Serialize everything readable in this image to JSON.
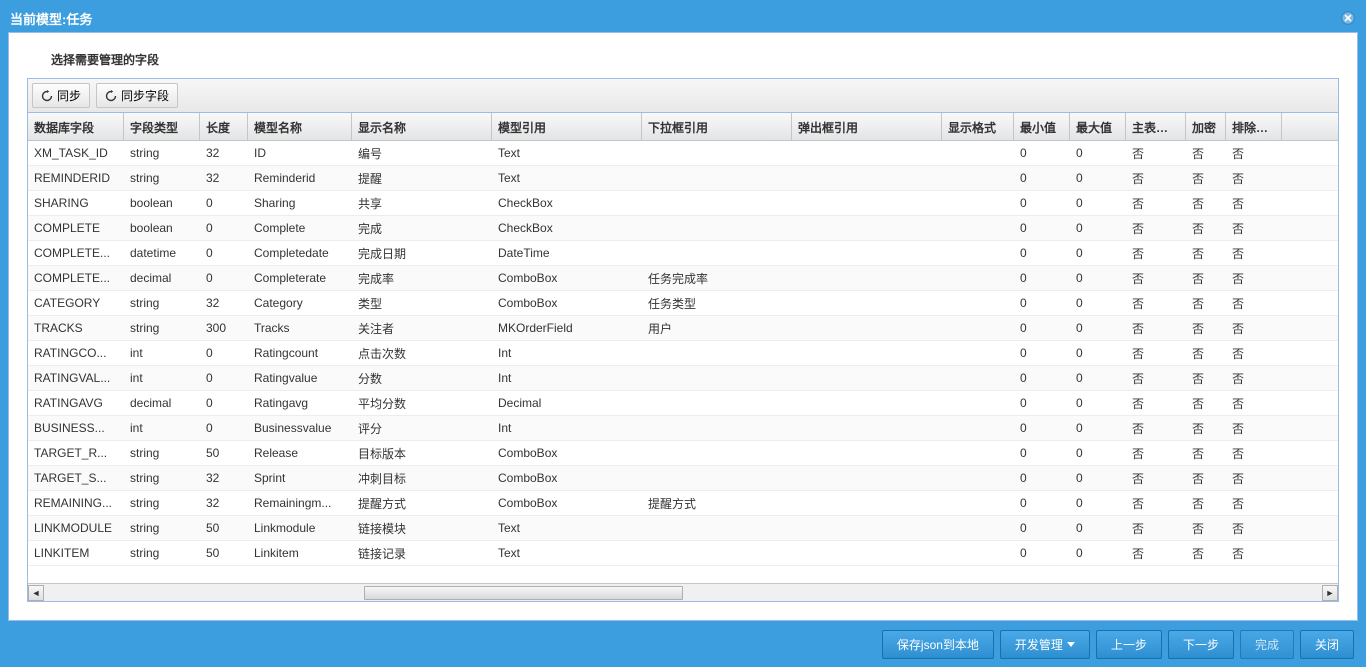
{
  "title": "当前模型:任务",
  "section_label": "选择需要管理的字段",
  "toolbar": {
    "sync": "同步",
    "sync_fields": "同步字段"
  },
  "columns": {
    "db_field": "数据库字段",
    "field_type": "字段类型",
    "length": "长度",
    "model_name": "模型名称",
    "display_name": "显示名称",
    "model_ref": "模型引用",
    "dropdown_ref": "下拉框引用",
    "popup_ref": "弹出框引用",
    "display_format": "显示格式",
    "min": "最小值",
    "max": "最大值",
    "master_link": "主表连排",
    "encrypt": "加密",
    "exclude_audit": "排除审计"
  },
  "rows": [
    {
      "db": "XM_TASK_ID",
      "ft": "string",
      "len": "32",
      "mn": "ID",
      "dn": "编号",
      "mr": "Text",
      "dd": "",
      "pp": "",
      "fmt": "",
      "min": "0",
      "max": "0",
      "mst": "否",
      "enc": "否",
      "exc": "否"
    },
    {
      "db": "REMINDERID",
      "ft": "string",
      "len": "32",
      "mn": "Reminderid",
      "dn": "提醒",
      "mr": "Text",
      "dd": "",
      "pp": "",
      "fmt": "",
      "min": "0",
      "max": "0",
      "mst": "否",
      "enc": "否",
      "exc": "否"
    },
    {
      "db": "SHARING",
      "ft": "boolean",
      "len": "0",
      "mn": "Sharing",
      "dn": "共享",
      "mr": "CheckBox",
      "dd": "",
      "pp": "",
      "fmt": "",
      "min": "0",
      "max": "0",
      "mst": "否",
      "enc": "否",
      "exc": "否"
    },
    {
      "db": "COMPLETE",
      "ft": "boolean",
      "len": "0",
      "mn": "Complete",
      "dn": "完成",
      "mr": "CheckBox",
      "dd": "",
      "pp": "",
      "fmt": "",
      "min": "0",
      "max": "0",
      "mst": "否",
      "enc": "否",
      "exc": "否"
    },
    {
      "db": "COMPLETE...",
      "ft": "datetime",
      "len": "0",
      "mn": "Completedate",
      "dn": "完成日期",
      "mr": "DateTime",
      "dd": "",
      "pp": "",
      "fmt": "",
      "min": "0",
      "max": "0",
      "mst": "否",
      "enc": "否",
      "exc": "否"
    },
    {
      "db": "COMPLETE...",
      "ft": "decimal",
      "len": "0",
      "mn": "Completerate",
      "dn": "完成率",
      "mr": "ComboBox",
      "dd": "任务完成率",
      "pp": "",
      "fmt": "",
      "min": "0",
      "max": "0",
      "mst": "否",
      "enc": "否",
      "exc": "否"
    },
    {
      "db": "CATEGORY",
      "ft": "string",
      "len": "32",
      "mn": "Category",
      "dn": "类型",
      "mr": "ComboBox",
      "dd": "任务类型",
      "pp": "",
      "fmt": "",
      "min": "0",
      "max": "0",
      "mst": "否",
      "enc": "否",
      "exc": "否"
    },
    {
      "db": "TRACKS",
      "ft": "string",
      "len": "300",
      "mn": "Tracks",
      "dn": "关注者",
      "mr": "MKOrderField",
      "dd": "用户",
      "pp": "",
      "fmt": "",
      "min": "0",
      "max": "0",
      "mst": "否",
      "enc": "否",
      "exc": "否"
    },
    {
      "db": "RATINGCO...",
      "ft": "int",
      "len": "0",
      "mn": "Ratingcount",
      "dn": "点击次数",
      "mr": "Int",
      "dd": "",
      "pp": "",
      "fmt": "",
      "min": "0",
      "max": "0",
      "mst": "否",
      "enc": "否",
      "exc": "否"
    },
    {
      "db": "RATINGVAL...",
      "ft": "int",
      "len": "0",
      "mn": "Ratingvalue",
      "dn": "分数",
      "mr": "Int",
      "dd": "",
      "pp": "",
      "fmt": "",
      "min": "0",
      "max": "0",
      "mst": "否",
      "enc": "否",
      "exc": "否"
    },
    {
      "db": "RATINGAVG",
      "ft": "decimal",
      "len": "0",
      "mn": "Ratingavg",
      "dn": "平均分数",
      "mr": "Decimal",
      "dd": "",
      "pp": "",
      "fmt": "",
      "min": "0",
      "max": "0",
      "mst": "否",
      "enc": "否",
      "exc": "否"
    },
    {
      "db": "BUSINESS...",
      "ft": "int",
      "len": "0",
      "mn": "Businessvalue",
      "dn": "评分",
      "mr": "Int",
      "dd": "",
      "pp": "",
      "fmt": "",
      "min": "0",
      "max": "0",
      "mst": "否",
      "enc": "否",
      "exc": "否"
    },
    {
      "db": "TARGET_R...",
      "ft": "string",
      "len": "50",
      "mn": "Release",
      "dn": "目标版本",
      "mr": "ComboBox",
      "dd": "",
      "pp": "",
      "fmt": "",
      "min": "0",
      "max": "0",
      "mst": "否",
      "enc": "否",
      "exc": "否"
    },
    {
      "db": "TARGET_S...",
      "ft": "string",
      "len": "32",
      "mn": "Sprint",
      "dn": "冲刺目标",
      "mr": "ComboBox",
      "dd": "",
      "pp": "",
      "fmt": "",
      "min": "0",
      "max": "0",
      "mst": "否",
      "enc": "否",
      "exc": "否"
    },
    {
      "db": "REMAINING...",
      "ft": "string",
      "len": "32",
      "mn": "Remainingm...",
      "dn": "提醒方式",
      "mr": "ComboBox",
      "dd": "提醒方式",
      "pp": "",
      "fmt": "",
      "min": "0",
      "max": "0",
      "mst": "否",
      "enc": "否",
      "exc": "否"
    },
    {
      "db": "LINKMODULE",
      "ft": "string",
      "len": "50",
      "mn": "Linkmodule",
      "dn": "链接模块",
      "mr": "Text",
      "dd": "",
      "pp": "",
      "fmt": "",
      "min": "0",
      "max": "0",
      "mst": "否",
      "enc": "否",
      "exc": "否"
    },
    {
      "db": "LINKITEM",
      "ft": "string",
      "len": "50",
      "mn": "Linkitem",
      "dn": "链接记录",
      "mr": "Text",
      "dd": "",
      "pp": "",
      "fmt": "",
      "min": "0",
      "max": "0",
      "mst": "否",
      "enc": "否",
      "exc": "否"
    }
  ],
  "footer": {
    "save_json": "保存json到本地",
    "dev_manage": "开发管理",
    "prev": "上一步",
    "next": "下一步",
    "finish": "完成",
    "close": "关闭"
  }
}
